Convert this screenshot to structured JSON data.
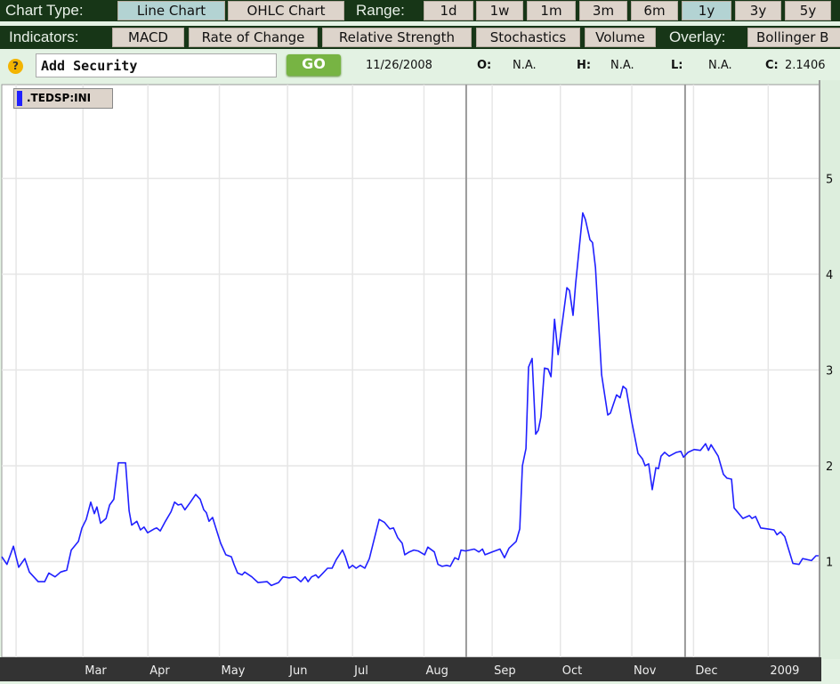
{
  "toolbar": {
    "chart_type_label": "Chart Type:",
    "chart_types": [
      {
        "label": "Line Chart",
        "active": true
      },
      {
        "label": "OHLC Chart",
        "active": false
      }
    ],
    "range_label": "Range:",
    "ranges": [
      {
        "label": "1d"
      },
      {
        "label": "1w"
      },
      {
        "label": "1m"
      },
      {
        "label": "3m"
      },
      {
        "label": "6m"
      },
      {
        "label": "1y",
        "active": true
      },
      {
        "label": "3y"
      },
      {
        "label": "5y"
      }
    ],
    "indicators_label": "Indicators:",
    "indicators": [
      "MACD",
      "Rate of Change",
      "Relative Strength",
      "Stochastics",
      "Volume"
    ],
    "overlay_label": "Overlay:",
    "overlays": [
      "Bollinger B"
    ]
  },
  "security": {
    "help_icon": "question-icon",
    "input_value": "Add Security",
    "go_label": "GO",
    "date": "11/26/2008",
    "open_label": "O:",
    "open": "N.A.",
    "high_label": "H:",
    "high": "N.A.",
    "low_label": "L:",
    "low": "N.A.",
    "close_label": "C:",
    "close": "2.1406"
  },
  "colors": {
    "line": "#2020ff",
    "toolbar_bg": "#173617",
    "button": "#ddd4cb",
    "active_button": "#b3d3d3",
    "go": "#77b443",
    "axis_bar": "#333333"
  },
  "chart_data": {
    "type": "line",
    "title": "",
    "legend": [
      ".TEDSP:INI"
    ],
    "legend_placement": "top-left",
    "xlabel": "",
    "ylabel": "",
    "xlim": [
      0,
      251.8
    ],
    "ylim": [
      0,
      5.98
    ],
    "grid": true,
    "y_ticks": [
      1,
      2,
      3,
      4,
      5
    ],
    "x_ticks": [
      {
        "label": "Mar",
        "x": 25
      },
      {
        "label": "Apr",
        "x": 45
      },
      {
        "label": "May",
        "x": 67
      },
      {
        "label": "Jun",
        "x": 88
      },
      {
        "label": "Jul",
        "x": 108
      },
      {
        "label": "Aug",
        "x": 130
      },
      {
        "label": "Sep",
        "x": 151
      },
      {
        "label": "Oct",
        "x": 172
      },
      {
        "label": "Nov",
        "x": 194
      },
      {
        "label": "Dec",
        "x": 213
      },
      {
        "label": "2009",
        "x": 236
      }
    ],
    "extra_grid_x": [
      4.4
    ],
    "markers_x": [
      143,
      210.4
    ],
    "series": [
      {
        "name": ".TEDSP:INI",
        "points": [
          [
            0,
            1.05
          ],
          [
            1.6,
            0.97
          ],
          [
            3.6,
            1.16
          ],
          [
            5.2,
            0.94
          ],
          [
            7.1,
            1.03
          ],
          [
            8.5,
            0.89
          ],
          [
            11.2,
            0.79
          ],
          [
            13.2,
            0.79
          ],
          [
            14.5,
            0.88
          ],
          [
            16.4,
            0.84
          ],
          [
            18.1,
            0.89
          ],
          [
            20.0,
            0.91
          ],
          [
            21.4,
            1.12
          ],
          [
            23.6,
            1.21
          ],
          [
            24.7,
            1.35
          ],
          [
            26.0,
            1.44
          ],
          [
            27.4,
            1.62
          ],
          [
            28.5,
            1.5
          ],
          [
            29.3,
            1.57
          ],
          [
            30.4,
            1.4
          ],
          [
            32.1,
            1.45
          ],
          [
            33.2,
            1.59
          ],
          [
            34.5,
            1.65
          ],
          [
            35.9,
            2.03
          ],
          [
            38.1,
            2.03
          ],
          [
            39.2,
            1.53
          ],
          [
            40.0,
            1.38
          ],
          [
            41.6,
            1.42
          ],
          [
            42.7,
            1.33
          ],
          [
            43.8,
            1.36
          ],
          [
            44.9,
            1.3
          ],
          [
            46.9,
            1.34
          ],
          [
            47.7,
            1.35
          ],
          [
            48.8,
            1.32
          ],
          [
            50.4,
            1.42
          ],
          [
            52.1,
            1.52
          ],
          [
            53.2,
            1.62
          ],
          [
            54.3,
            1.59
          ],
          [
            55.3,
            1.6
          ],
          [
            56.4,
            1.54
          ],
          [
            58.1,
            1.62
          ],
          [
            59.7,
            1.7
          ],
          [
            61.1,
            1.65
          ],
          [
            62.2,
            1.54
          ],
          [
            63.0,
            1.51
          ],
          [
            63.8,
            1.42
          ],
          [
            64.9,
            1.46
          ],
          [
            66.0,
            1.34
          ],
          [
            67.4,
            1.19
          ],
          [
            69.0,
            1.07
          ],
          [
            70.7,
            1.05
          ],
          [
            71.5,
            0.97
          ],
          [
            72.6,
            0.88
          ],
          [
            74.0,
            0.86
          ],
          [
            74.8,
            0.89
          ],
          [
            77.0,
            0.84
          ],
          [
            78.9,
            0.78
          ],
          [
            81.7,
            0.79
          ],
          [
            83.0,
            0.75
          ],
          [
            85.2,
            0.78
          ],
          [
            86.6,
            0.84
          ],
          [
            88.5,
            0.83
          ],
          [
            90.4,
            0.84
          ],
          [
            92.1,
            0.79
          ],
          [
            93.4,
            0.84
          ],
          [
            94.3,
            0.79
          ],
          [
            95.4,
            0.84
          ],
          [
            96.7,
            0.86
          ],
          [
            97.5,
            0.83
          ],
          [
            98.9,
            0.88
          ],
          [
            100.3,
            0.93
          ],
          [
            101.7,
            0.93
          ],
          [
            103.0,
            1.02
          ],
          [
            104.9,
            1.12
          ],
          [
            105.8,
            1.05
          ],
          [
            106.9,
            0.93
          ],
          [
            108.0,
            0.96
          ],
          [
            109.1,
            0.93
          ],
          [
            110.4,
            0.96
          ],
          [
            111.8,
            0.93
          ],
          [
            113.2,
            1.03
          ],
          [
            114.5,
            1.21
          ],
          [
            116.2,
            1.44
          ],
          [
            117.8,
            1.41
          ],
          [
            119.5,
            1.34
          ],
          [
            120.6,
            1.35
          ],
          [
            121.9,
            1.25
          ],
          [
            123.3,
            1.19
          ],
          [
            124.1,
            1.07
          ],
          [
            125.5,
            1.1
          ],
          [
            126.9,
            1.12
          ],
          [
            128.2,
            1.11
          ],
          [
            130.2,
            1.07
          ],
          [
            131.2,
            1.15
          ],
          [
            133.2,
            1.1
          ],
          [
            134.3,
            0.97
          ],
          [
            135.6,
            0.95
          ],
          [
            137.0,
            0.96
          ],
          [
            138.1,
            0.95
          ],
          [
            139.5,
            1.04
          ],
          [
            140.6,
            1.02
          ],
          [
            141.4,
            1.12
          ],
          [
            142.8,
            1.11
          ],
          [
            145.5,
            1.13
          ],
          [
            146.9,
            1.1
          ],
          [
            148.0,
            1.13
          ],
          [
            148.8,
            1.07
          ],
          [
            151.0,
            1.1
          ],
          [
            153.4,
            1.13
          ],
          [
            154.8,
            1.04
          ],
          [
            156.2,
            1.14
          ],
          [
            158.4,
            1.21
          ],
          [
            159.5,
            1.34
          ],
          [
            160.3,
            2.0
          ],
          [
            161.4,
            2.18
          ],
          [
            162.2,
            3.03
          ],
          [
            163.3,
            3.12
          ],
          [
            164.4,
            2.33
          ],
          [
            165.2,
            2.37
          ],
          [
            166.0,
            2.51
          ],
          [
            167.1,
            3.02
          ],
          [
            168.2,
            3.01
          ],
          [
            169.1,
            2.93
          ],
          [
            170.2,
            3.53
          ],
          [
            171.3,
            3.16
          ],
          [
            174.0,
            3.86
          ],
          [
            174.8,
            3.83
          ],
          [
            175.9,
            3.57
          ],
          [
            176.7,
            3.9
          ],
          [
            178.9,
            4.64
          ],
          [
            179.7,
            4.57
          ],
          [
            181.1,
            4.36
          ],
          [
            181.9,
            4.33
          ],
          [
            182.8,
            4.07
          ],
          [
            184.7,
            2.95
          ],
          [
            186.6,
            2.53
          ],
          [
            187.4,
            2.55
          ],
          [
            189.3,
            2.74
          ],
          [
            190.4,
            2.71
          ],
          [
            191.3,
            2.83
          ],
          [
            192.3,
            2.8
          ],
          [
            194.0,
            2.46
          ],
          [
            195.9,
            2.13
          ],
          [
            197.3,
            2.07
          ],
          [
            198.1,
            2.0
          ],
          [
            199.2,
            2.02
          ],
          [
            200.3,
            1.75
          ],
          [
            201.4,
            1.98
          ],
          [
            202.2,
            1.97
          ],
          [
            203.0,
            2.1
          ],
          [
            204.1,
            2.14
          ],
          [
            205.5,
            2.1
          ],
          [
            207.7,
            2.14
          ],
          [
            209.1,
            2.15
          ],
          [
            209.9,
            2.09
          ],
          [
            211.3,
            2.14
          ],
          [
            213.2,
            2.17
          ],
          [
            215.1,
            2.16
          ],
          [
            216.7,
            2.23
          ],
          [
            217.6,
            2.16
          ],
          [
            218.4,
            2.22
          ],
          [
            220.6,
            2.1
          ],
          [
            222.2,
            1.91
          ],
          [
            223.3,
            1.87
          ],
          [
            224.7,
            1.86
          ],
          [
            225.5,
            1.56
          ],
          [
            228.2,
            1.45
          ],
          [
            230.2,
            1.48
          ],
          [
            231.0,
            1.45
          ],
          [
            232.1,
            1.47
          ],
          [
            233.7,
            1.35
          ],
          [
            235.9,
            1.34
          ],
          [
            237.8,
            1.33
          ],
          [
            238.7,
            1.28
          ],
          [
            239.8,
            1.31
          ],
          [
            241.1,
            1.26
          ],
          [
            243.6,
            0.98
          ],
          [
            245.5,
            0.97
          ],
          [
            246.6,
            1.03
          ],
          [
            249.3,
            1.01
          ],
          [
            250.7,
            1.06
          ],
          [
            251.5,
            1.06
          ]
        ]
      }
    ]
  }
}
